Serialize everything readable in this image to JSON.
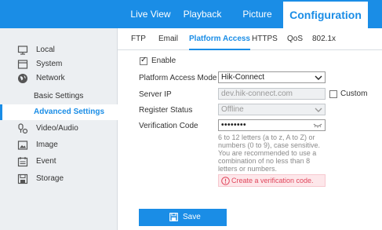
{
  "topnav": {
    "live_view": "Live View",
    "playback": "Playback",
    "picture": "Picture",
    "configuration": "Configuration"
  },
  "sidebar": {
    "items": [
      {
        "label": "Local",
        "icon": "monitor-icon"
      },
      {
        "label": "System",
        "icon": "system-icon"
      },
      {
        "label": "Network",
        "icon": "globe-icon"
      },
      {
        "label": "Basic Settings",
        "icon": ""
      },
      {
        "label": "Advanced Settings",
        "icon": ""
      },
      {
        "label": "Video/Audio",
        "icon": "video-audio-icon"
      },
      {
        "label": "Image",
        "icon": "image-icon"
      },
      {
        "label": "Event",
        "icon": "calendar-icon"
      },
      {
        "label": "Storage",
        "icon": "storage-icon"
      }
    ],
    "active_index": 4
  },
  "tabs": [
    "FTP",
    "Email",
    "Platform Access",
    "HTTPS",
    "QoS",
    "802.1x"
  ],
  "active_tab": "Platform Access",
  "form": {
    "enable_label": "Enable",
    "enable_checked": true,
    "mode_label": "Platform Access Mode",
    "mode_value": "Hik-Connect",
    "server_ip_label": "Server IP",
    "server_ip_value": "dev.hik-connect.com",
    "custom_label": "Custom",
    "custom_checked": false,
    "register_status_label": "Register Status",
    "register_status_value": "Offline",
    "verification_label": "Verification Code",
    "verification_value": "••••••••",
    "help_text": "6 to 12 letters (a to z, A to Z) or numbers (0 to 9), case sensitive. You are recommended to use a combination of no less than 8 letters or numbers.",
    "error_text": "Create a verification code."
  },
  "save_label": "Save",
  "colors": {
    "accent": "#1a8de6",
    "error": "#e0475d",
    "sidebar_bg": "#eceff2"
  }
}
